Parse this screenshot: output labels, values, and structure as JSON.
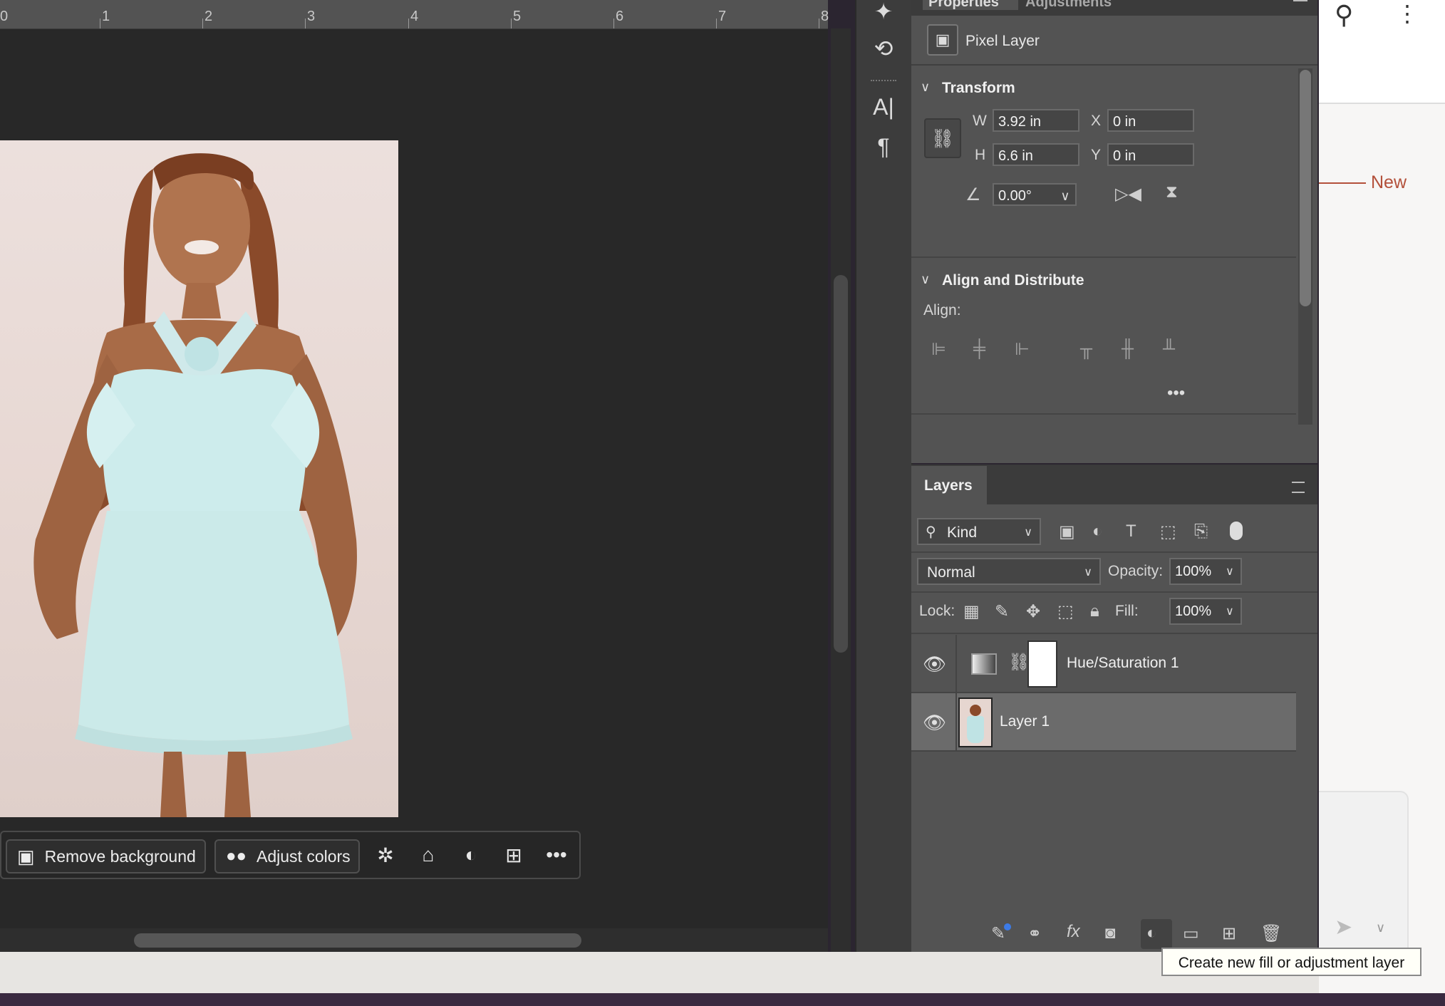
{
  "ruler": {
    "marks": [
      "0",
      "1",
      "2",
      "3",
      "4",
      "5",
      "6",
      "7",
      "8"
    ]
  },
  "context_bar": {
    "remove_bg_label": "Remove background",
    "adjust_colors_label": "Adjust colors",
    "icons": [
      "sparkle-select-icon",
      "transform-icon",
      "adjustment-icon",
      "add-image-icon",
      "more-icon"
    ]
  },
  "tools": [
    "select-subject-icon",
    "rotate-icon",
    "type-icon",
    "paragraph-icon"
  ],
  "properties": {
    "tabs": [
      "Properties",
      "Adjustments"
    ],
    "layer_type": "Pixel Layer",
    "transform": {
      "title": "Transform",
      "w_label": "W",
      "w_value": "3.92 in",
      "h_label": "H",
      "h_value": "6.6 in",
      "x_label": "X",
      "x_value": "0 in",
      "y_label": "Y",
      "y_value": "0 in",
      "angle_value": "0.00°"
    },
    "align": {
      "title": "Align and Distribute",
      "align_label": "Align:",
      "more": "•••"
    }
  },
  "layers": {
    "tab_label": "Layers",
    "filter_kind": "Kind",
    "blend_mode": "Normal",
    "opacity_label": "Opacity:",
    "opacity_value": "100%",
    "lock_label": "Lock:",
    "fill_label": "Fill:",
    "fill_value": "100%",
    "items": [
      {
        "name": "Hue/Saturation 1",
        "selected": false
      },
      {
        "name": "Layer 1",
        "selected": true
      }
    ]
  },
  "browser": {
    "new_label": "New"
  },
  "tooltip": "Create new fill or adjustment layer",
  "colors": {
    "accent_new": "#b3503a",
    "selected_row": "#6b6b6b",
    "panel": "#535353"
  }
}
